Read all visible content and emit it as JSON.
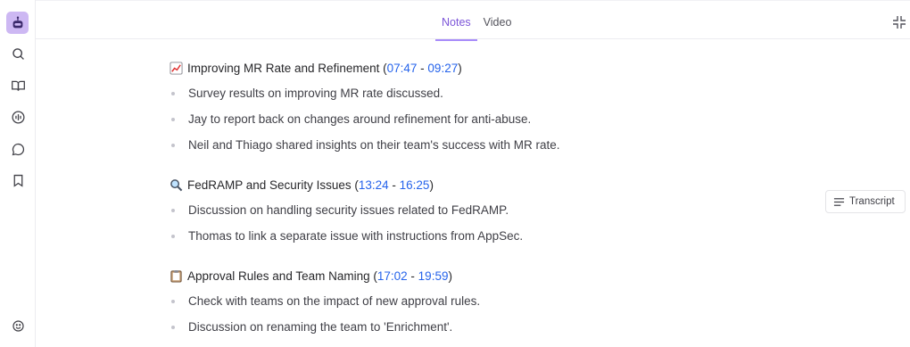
{
  "sidebar": {
    "items": [
      {
        "icon": "app-logo-icon"
      },
      {
        "icon": "search-icon"
      },
      {
        "icon": "book-icon"
      },
      {
        "icon": "audio-waveform-icon"
      },
      {
        "icon": "chat-bubble-icon"
      },
      {
        "icon": "bookmark-icon"
      },
      {
        "icon": "smiley-icon"
      }
    ]
  },
  "header": {
    "tabs": [
      {
        "label": "Notes",
        "active": true
      },
      {
        "label": "Video",
        "active": false
      }
    ],
    "collapse_icon": "collapse-icon"
  },
  "notes": {
    "sections": [
      {
        "emoji": "chart-increasing-emoji",
        "title": "Improving MR Rate and Refinement",
        "open_paren": "(",
        "start": "07:47",
        "dash": " - ",
        "end": "09:27",
        "close_paren": ")",
        "bullets": [
          "Survey results on improving MR rate discussed.",
          "Jay to report back on changes around refinement for anti-abuse.",
          "Neil and Thiago shared insights on their team's success with MR rate."
        ]
      },
      {
        "emoji": "magnifying-glass-emoji",
        "title": "FedRAMP and Security Issues",
        "open_paren": "(",
        "start": "13:24",
        "dash": " - ",
        "end": "16:25",
        "close_paren": ")",
        "bullets": [
          "Discussion on handling security issues related to FedRAMP.",
          "Thomas to link a separate issue with instructions from AppSec."
        ]
      },
      {
        "emoji": "clipboard-emoji",
        "title": "Approval Rules and Team Naming",
        "open_paren": "(",
        "start": "17:02",
        "dash": " - ",
        "end": "19:59",
        "close_paren": ")",
        "bullets": [
          "Check with teams on the impact of new approval rules.",
          "Discussion on renaming the team to 'Enrichment'."
        ]
      }
    ]
  },
  "transcript_button": {
    "label": "Transcript",
    "icon": "lines-icon"
  },
  "colors": {
    "accent": "#7c55d8",
    "timestamp": "#2563eb",
    "logo_bg": "#cdb8f3"
  }
}
